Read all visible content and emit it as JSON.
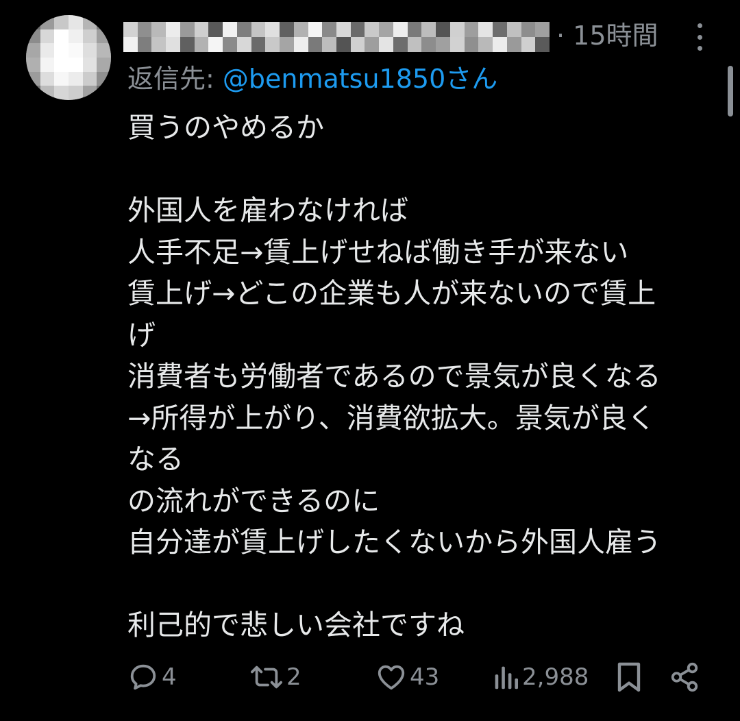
{
  "tweet": {
    "timestamp": "· 15時間",
    "reply_to_label": "返信先: ",
    "reply_to_handle": "@benmatsu1850",
    "reply_to_suffix": "さん",
    "lines": [
      "買うのやめるか",
      "",
      "外国人を雇わなければ",
      "人手不足→賃上げせねば働き手が来ない",
      "賃上げ→どこの企業も人が来ないので賃上",
      "げ",
      "消費者も労働者であるので景気が良くなる",
      "→所得が上がり、消費欲拡大。景気が良く",
      "なる",
      "の流れができるのに",
      "自分達が賃上げしたくないから外国人雇う",
      "",
      "利己的で悲しい会社ですね"
    ]
  },
  "actions": {
    "reply": {
      "icon": "reply-icon",
      "count": "4"
    },
    "retweet": {
      "icon": "retweet-icon",
      "count": "2"
    },
    "like": {
      "icon": "heart-icon",
      "count": "43"
    },
    "views": {
      "icon": "views-icon",
      "count": "2,988"
    },
    "bookmark": {
      "icon": "bookmark-icon"
    },
    "share": {
      "icon": "share-icon"
    }
  },
  "colors": {
    "background": "#000000",
    "text": "#e7e9ea",
    "muted": "#8b9096",
    "link": "#1d9bf0"
  }
}
